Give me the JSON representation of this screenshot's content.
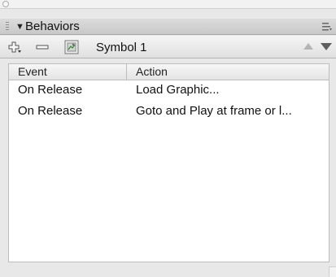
{
  "panel": {
    "title": "Behaviors",
    "disclosure": "▼"
  },
  "toolbar": {
    "add_icon": "add-behavior-icon",
    "remove_icon": "remove-behavior-icon",
    "symbol_icon": "symbol-icon",
    "symbol_label": "Symbol 1",
    "move_up_icon": "move-up-icon",
    "move_down_icon": "move-down-icon"
  },
  "table": {
    "columns": [
      "Event",
      "Action"
    ],
    "rows": [
      {
        "event": "On Release",
        "action": "Load Graphic..."
      },
      {
        "event": "On Release",
        "action": "Goto and Play at frame or l..."
      }
    ]
  },
  "colors": {
    "header_bg": "#c8c8c8",
    "toolbar_bg": "#e0e0e0",
    "table_bg": "#ffffff"
  }
}
